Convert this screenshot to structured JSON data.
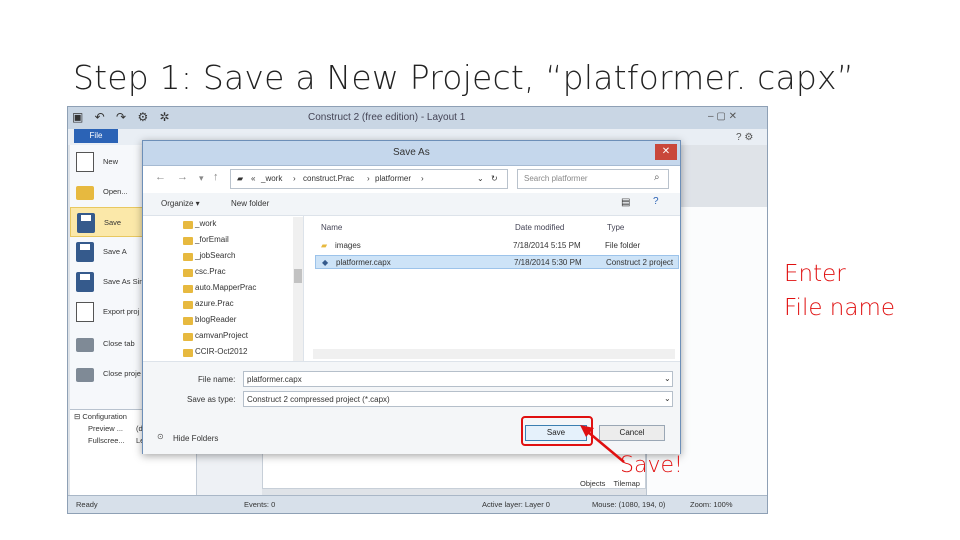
{
  "slide": {
    "title": "Step 1: Save a New Project, “platformer. capx”",
    "callout_line1": "Enter",
    "callout_line2": "File name",
    "save_callout": "Save!",
    "accent_color": "#e01010"
  },
  "app": {
    "window_title": "Construct 2  (free edition) - Layout 1",
    "file_tab": "File",
    "quick_access": "▣ ↶ ↷ ⚙ ✲",
    "window_controls": "–  ▢  ✕",
    "help": "? ⚙",
    "file_menu": [
      {
        "label": "New",
        "icon": "new-document-icon"
      },
      {
        "label": "Open...",
        "icon": "open-folder-icon"
      },
      {
        "label": "Save",
        "icon": "save-disk-icon"
      },
      {
        "label": "Save A",
        "icon": "save-as-icon"
      },
      {
        "label": "Save As Sin",
        "icon": "save-as-single-icon"
      },
      {
        "label": "Export proj",
        "icon": "export-icon"
      },
      {
        "label": "Close tab",
        "icon": "close-tab-icon"
      },
      {
        "label": "Close proje",
        "icon": "close-project-icon"
      }
    ],
    "config_header": "⊟ Configuration",
    "config_rows": [
      {
        "name": "Preview ...",
        "value": "(d"
      },
      {
        "name": "Fullscree...",
        "value": "Le"
      }
    ],
    "bottom_tabs": [
      "Objects",
      "Tilemap"
    ],
    "status": {
      "ready": "Ready",
      "events": "Events: 0",
      "active_layer": "Active layer: Layer 0",
      "mouse": "Mouse: (1080, 194, 0)",
      "zoom": "Zoom: 100%"
    }
  },
  "dialog": {
    "title": "Save As",
    "close": "✕",
    "address": [
      "«",
      "_work",
      "›",
      "construct.Prac",
      "›",
      "platformer",
      "›"
    ],
    "search_placeholder": "Search platformer",
    "organize": "Organize ▾",
    "new_folder": "New folder",
    "tree": [
      "_work",
      "_forEmail",
      "_jobSearch",
      "csc.Prac",
      "auto.MapperPrac",
      "azure.Prac",
      "blogReader",
      "camvanProject",
      "CCIR-Oct2012"
    ],
    "columns": [
      "Name",
      "Date modified",
      "Type"
    ],
    "files": [
      {
        "name": "images",
        "date": "7/18/2014 5:15 PM",
        "type": "File folder",
        "selected": false
      },
      {
        "name": "platformer.capx",
        "date": "7/18/2014 5:30 PM",
        "type": "Construct 2 project",
        "selected": true
      }
    ],
    "file_name_label": "File name:",
    "file_name_value": "platformer.capx",
    "save_type_label": "Save as type:",
    "save_type_value": "Construct 2 compressed project (*.capx)",
    "hide_folders": "Hide Folders",
    "save_button": "Save",
    "cancel_button": "Cancel"
  }
}
